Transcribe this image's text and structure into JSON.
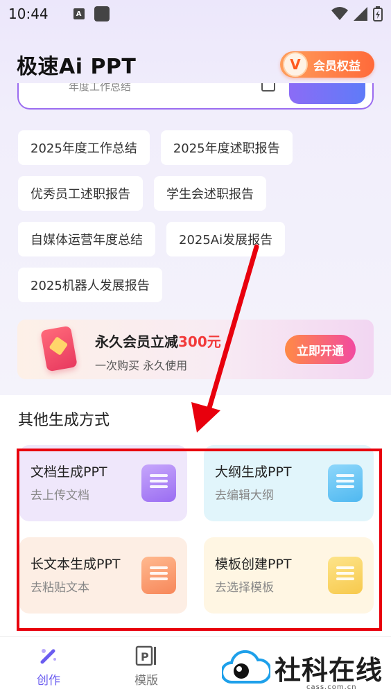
{
  "status_bar": {
    "time": "10:44",
    "a_icon": "A"
  },
  "header": {
    "title": "极速Ai PPT",
    "vip_badge": "V",
    "vip_label": "会员权益"
  },
  "search": {
    "ghost_text": "年度工作总结",
    "generate_label": ""
  },
  "suggestion_chips": [
    [
      "2025年度工作总结",
      "2025年度述职报告"
    ],
    [
      "优秀员工述职报告",
      "学生会述职报告"
    ],
    [
      "自媒体运营年度总结",
      "2025Ai发展报告"
    ],
    [
      "2025机器人发展报告"
    ]
  ],
  "promo": {
    "title_prefix": "永久会员立减",
    "title_amount": "300元",
    "subtitle": "一次购买 永久使用",
    "button": "立即开通"
  },
  "other_methods": {
    "title": "其他生成方式",
    "cards": [
      {
        "title": "文档生成PPT",
        "subtitle": "去上传文档",
        "icon": "document-icon"
      },
      {
        "title": "大纲生成PPT",
        "subtitle": "去编辑大纲",
        "icon": "outline-icon"
      },
      {
        "title": "长文本生成PPT",
        "subtitle": "去粘贴文本",
        "icon": "text-icon"
      },
      {
        "title": "模板创建PPT",
        "subtitle": "去选择模板",
        "icon": "template-grid-icon"
      }
    ]
  },
  "bottom_nav": [
    {
      "label": "创作",
      "icon": "magic-wand-icon",
      "active": true
    },
    {
      "label": "模版",
      "icon": "ppt-icon",
      "active": false
    }
  ],
  "watermark": {
    "text": "社科在线",
    "url": "cass.com.cn"
  },
  "colors": {
    "accent": "#6a5cf0",
    "annotation_red": "#e8000d",
    "promo_highlight": "#f23a3a"
  }
}
